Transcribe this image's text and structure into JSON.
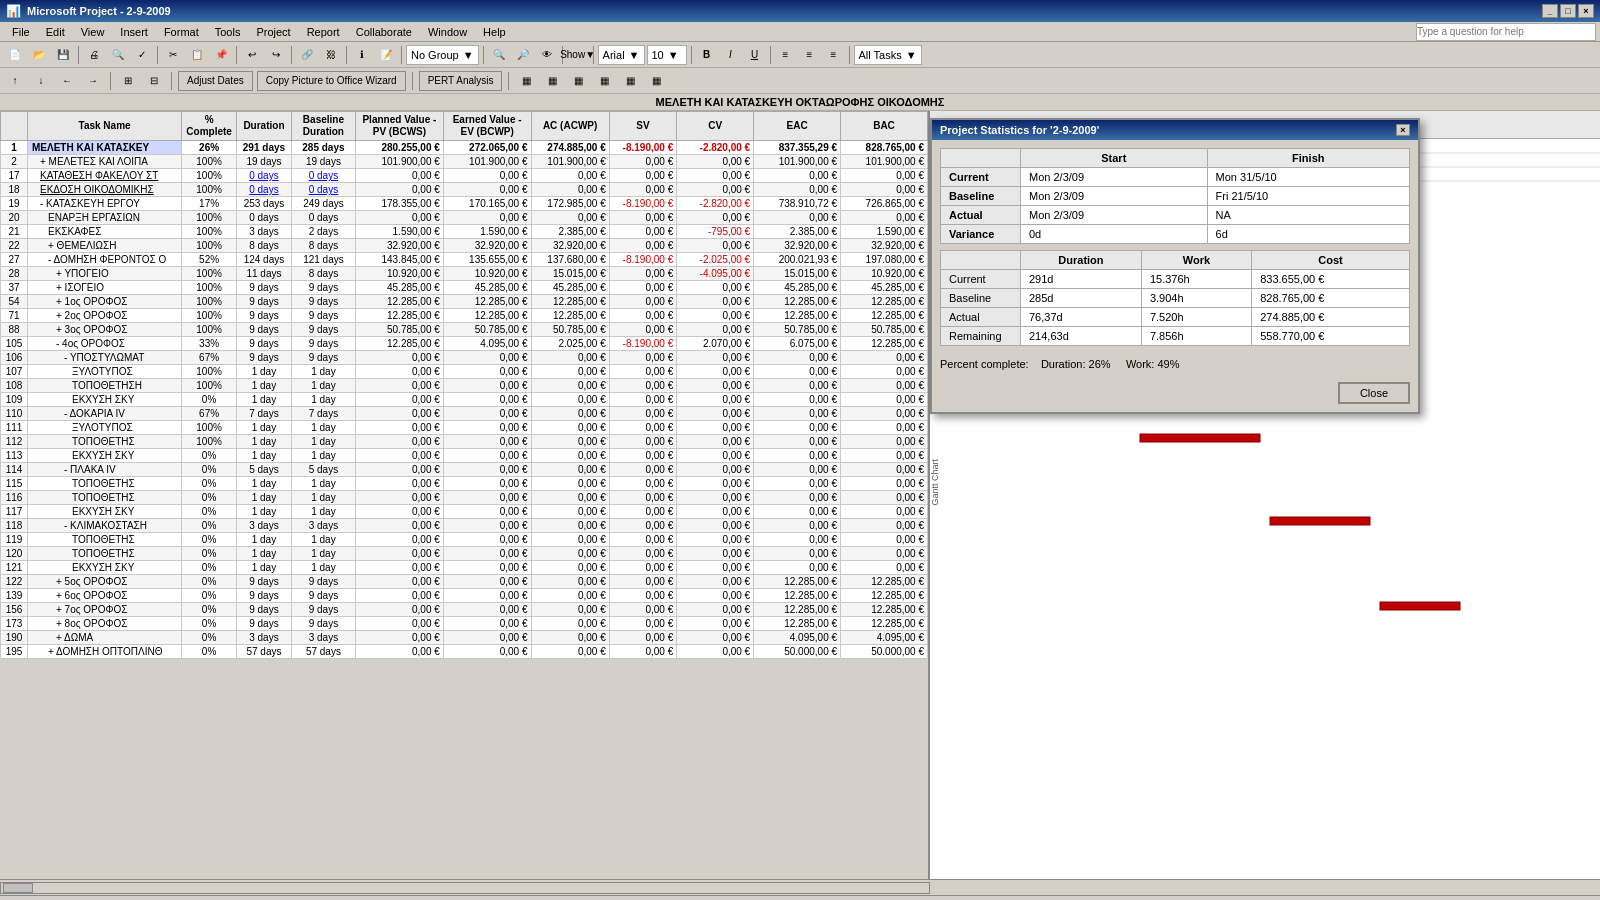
{
  "titleBar": {
    "title": "Microsoft Project - 2-9-2009",
    "buttons": [
      "_",
      "□",
      "×"
    ]
  },
  "menuBar": {
    "items": [
      "File",
      "Edit",
      "View",
      "Insert",
      "Format",
      "Tools",
      "Project",
      "Report",
      "Collaborate",
      "Window",
      "Help"
    ]
  },
  "toolbar": {
    "noGroup": "No Group",
    "fontSize": "10",
    "fontName": "Arial",
    "allTasks": "All Tasks",
    "show": "Show"
  },
  "toolbar2": {
    "adjustDates": "Adjust Dates",
    "copyPicture": "Copy Picture to Office Wizard",
    "pertAnalysis": "PERT Analysis"
  },
  "projectTitle": "ΜΕΛΕΤΗ ΚΑΙ ΚΑΤΑΣΚΕΥΗ ΟΚΤΑΩΡΟΦΗΣ ΟΙΚΟΔΟΜΗΣ",
  "tableHeaders": {
    "num": "#",
    "taskName": "Task Name",
    "pctComplete": "% Complete",
    "duration": "Duration",
    "baselineDuration": "Baseline Duration",
    "pv": "Planned Value - PV (BCWS)",
    "ev": "Earned Value - EV (BCWP)",
    "ac": "AC (ACWP)",
    "sv": "SV",
    "cv": "CV",
    "eac": "EAC",
    "bac": "BAC"
  },
  "rows": [
    {
      "num": "1",
      "name": "ΜΕΛΕΤΗ ΚΑΙ ΚΑΤΑΣΚΕΥ",
      "pct": "26%",
      "dur": "291 days",
      "base": "285 days",
      "pv": "280.255,00 €",
      "ev": "272.065,00 €",
      "ac": "274.885,00 €",
      "sv": "-8.190,00 €",
      "cv": "-2.820,00 €",
      "eac": "837.355,29 €",
      "bac": "828.765,00 €",
      "bold": true,
      "indent": 0
    },
    {
      "num": "2",
      "name": "+ ΜΕΛΕΤΕΣ ΚΑΙ ΛΟΙΠΑ",
      "pct": "100%",
      "dur": "19 days",
      "base": "19 days",
      "pv": "101.900,00 €",
      "ev": "101.900,00 €",
      "ac": "101.900,00 €",
      "sv": "0,00 €",
      "cv": "0,00 €",
      "eac": "101.900,00 €",
      "bac": "101.900,00 €",
      "bold": false,
      "indent": 1
    },
    {
      "num": "17",
      "name": "ΚΑΤΑΘΕΣΗ ΦΑΚΕΛΟΥ ΣΤ",
      "pct": "100%",
      "dur": "0 days",
      "base": "0 days",
      "pv": "0,00 €",
      "ev": "0,00 €",
      "ac": "0,00 €",
      "sv": "0,00 €",
      "cv": "0,00 €",
      "eac": "0,00 €",
      "bac": "0,00 €",
      "bold": false,
      "indent": 1,
      "underline": true
    },
    {
      "num": "18",
      "name": "ΕΚΔΟΣΗ ΟΙΚΟΔΟΜΙΚΗΣ",
      "pct": "100%",
      "dur": "0 days",
      "base": "0 days",
      "pv": "0,00 €",
      "ev": "0,00 €",
      "ac": "0,00 €",
      "sv": "0,00 €",
      "cv": "0,00 €",
      "eac": "0,00 €",
      "bac": "0,00 €",
      "bold": false,
      "indent": 1,
      "underline": true
    },
    {
      "num": "19",
      "name": "- ΚΑΤΑΣΚΕΥΗ ΕΡΓΟΥ",
      "pct": "17%",
      "dur": "253 days",
      "base": "249 days",
      "pv": "178.355,00 €",
      "ev": "170.165,00 €",
      "ac": "172.985,00 €",
      "sv": "-8.190,00 €",
      "cv": "-2.820,00 €",
      "eac": "738.910,72 €",
      "bac": "726.865,00 €",
      "bold": false,
      "indent": 1
    },
    {
      "num": "20",
      "name": "ΕΝΑΡΞΗ ΕΡΓΑΣΙΩΝ",
      "pct": "100%",
      "dur": "0 days",
      "base": "0 days",
      "pv": "0,00 €",
      "ev": "0,00 €",
      "ac": "0,00 €",
      "sv": "0,00 €",
      "cv": "0,00 €",
      "eac": "0,00 €",
      "bac": "0,00 €",
      "bold": false,
      "indent": 2
    },
    {
      "num": "21",
      "name": "ΕΚΣΚΑΦΕΣ",
      "pct": "100%",
      "dur": "3 days",
      "base": "2 days",
      "pv": "1.590,00 €",
      "ev": "1.590,00 €",
      "ac": "2.385,00 €",
      "sv": "0,00 €",
      "cv": "-795,00 €",
      "eac": "2.385,00 €",
      "bac": "1.590,00 €",
      "bold": false,
      "indent": 2
    },
    {
      "num": "22",
      "name": "+ ΘΕΜΕΛΙΩΣΗ",
      "pct": "100%",
      "dur": "8 days",
      "base": "8 days",
      "pv": "32.920,00 €",
      "ev": "32.920,00 €",
      "ac": "32.920,00 €",
      "sv": "0,00 €",
      "cv": "0,00 €",
      "eac": "32.920,00 €",
      "bac": "32.920,00 €",
      "bold": false,
      "indent": 2
    },
    {
      "num": "27",
      "name": "- ΔΟΜΗΣΗ ΦΕΡΟΝΤΟΣ Ο",
      "pct": "52%",
      "dur": "124 days",
      "base": "121 days",
      "pv": "143.845,00 €",
      "ev": "135.655,00 €",
      "ac": "137.680,00 €",
      "sv": "-8.190,00 €",
      "cv": "-2.025,00 €",
      "eac": "200.021,93 €",
      "bac": "197.080,00 €",
      "bold": false,
      "indent": 2
    },
    {
      "num": "28",
      "name": "+ ΥΠΟΓΕΙΟ",
      "pct": "100%",
      "dur": "11 days",
      "base": "8 days",
      "pv": "10.920,00 €",
      "ev": "10.920,00 €",
      "ac": "15.015,00 €",
      "sv": "0,00 €",
      "cv": "-4.095,00 €",
      "eac": "15.015,00 €",
      "bac": "10.920,00 €",
      "bold": false,
      "indent": 3
    },
    {
      "num": "37",
      "name": "+ ΙΣΟΓΕΙΟ",
      "pct": "100%",
      "dur": "9 days",
      "base": "9 days",
      "pv": "45.285,00 €",
      "ev": "45.285,00 €",
      "ac": "45.285,00 €",
      "sv": "0,00 €",
      "cv": "0,00 €",
      "eac": "45.285,00 €",
      "bac": "45.285,00 €",
      "bold": false,
      "indent": 3
    },
    {
      "num": "54",
      "name": "+ 1ος ΟΡΟΦΟΣ",
      "pct": "100%",
      "dur": "9 days",
      "base": "9 days",
      "pv": "12.285,00 €",
      "ev": "12.285,00 €",
      "ac": "12.285,00 €",
      "sv": "0,00 €",
      "cv": "0,00 €",
      "eac": "12.285,00 €",
      "bac": "12.285,00 €",
      "bold": false,
      "indent": 3
    },
    {
      "num": "71",
      "name": "+ 2ος ΟΡΟΦΟΣ",
      "pct": "100%",
      "dur": "9 days",
      "base": "9 days",
      "pv": "12.285,00 €",
      "ev": "12.285,00 €",
      "ac": "12.285,00 €",
      "sv": "0,00 €",
      "cv": "0,00 €",
      "eac": "12.285,00 €",
      "bac": "12.285,00 €",
      "bold": false,
      "indent": 3
    },
    {
      "num": "88",
      "name": "+ 3ος ΟΡΟΦΟΣ",
      "pct": "100%",
      "dur": "9 days",
      "base": "9 days",
      "pv": "50.785,00 €",
      "ev": "50.785,00 €",
      "ac": "50.785,00 €",
      "sv": "0,00 €",
      "cv": "0,00 €",
      "eac": "50.785,00 €",
      "bac": "50.785,00 €",
      "bold": false,
      "indent": 3
    },
    {
      "num": "105",
      "name": "- 4ος ΟΡΟΦΟΣ",
      "pct": "33%",
      "dur": "9 days",
      "base": "9 days",
      "pv": "12.285,00 €",
      "ev": "4.095,00 €",
      "ac": "2.025,00 €",
      "sv": "-8.190,00 €",
      "cv": "2.070,00 €",
      "eac": "6.075,00 €",
      "bac": "12.285,00 €",
      "bold": false,
      "indent": 3
    },
    {
      "num": "106",
      "name": "- ΥΠΟΣΤΥΛΩΜΑΤ",
      "pct": "67%",
      "dur": "9 days",
      "base": "9 days",
      "pv": "0,00 €",
      "ev": "0,00 €",
      "ac": "0,00 €",
      "sv": "0,00 €",
      "cv": "0,00 €",
      "eac": "0,00 €",
      "bac": "0,00 €",
      "bold": false,
      "indent": 4
    },
    {
      "num": "107",
      "name": "ΞΥΛΟΤΥΠΟΣ",
      "pct": "100%",
      "dur": "1 day",
      "base": "1 day",
      "pv": "0,00 €",
      "ev": "0,00 €",
      "ac": "0,00 €",
      "sv": "0,00 €",
      "cv": "0,00 €",
      "eac": "0,00 €",
      "bac": "0,00 €",
      "bold": false,
      "indent": 5
    },
    {
      "num": "108",
      "name": "ΤΟΠΟΘΕΤΗΣΗ",
      "pct": "100%",
      "dur": "1 day",
      "base": "1 day",
      "pv": "0,00 €",
      "ev": "0,00 €",
      "ac": "0,00 €",
      "sv": "0,00 €",
      "cv": "0,00 €",
      "eac": "0,00 €",
      "bac": "0,00 €",
      "bold": false,
      "indent": 5
    },
    {
      "num": "109",
      "name": "ΕΚΧΥΣΗ ΣΚΥ",
      "pct": "0%",
      "dur": "1 day",
      "base": "1 day",
      "pv": "0,00 €",
      "ev": "0,00 €",
      "ac": "0,00 €",
      "sv": "0,00 €",
      "cv": "0,00 €",
      "eac": "0,00 €",
      "bac": "0,00 €",
      "bold": false,
      "indent": 5
    },
    {
      "num": "110",
      "name": "- ΔΟΚΑΡΙΑ IV",
      "pct": "67%",
      "dur": "7 days",
      "base": "7 days",
      "pv": "0,00 €",
      "ev": "0,00 €",
      "ac": "0,00 €",
      "sv": "0,00 €",
      "cv": "0,00 €",
      "eac": "0,00 €",
      "bac": "0,00 €",
      "bold": false,
      "indent": 4
    },
    {
      "num": "111",
      "name": "ΞΥΛΟΤΥΠΟΣ",
      "pct": "100%",
      "dur": "1 day",
      "base": "1 day",
      "pv": "0,00 €",
      "ev": "0,00 €",
      "ac": "0,00 €",
      "sv": "0,00 €",
      "cv": "0,00 €",
      "eac": "0,00 €",
      "bac": "0,00 €",
      "bold": false,
      "indent": 5
    },
    {
      "num": "112",
      "name": "ΤΟΠΟΘΕΤΗΣ",
      "pct": "100%",
      "dur": "1 day",
      "base": "1 day",
      "pv": "0,00 €",
      "ev": "0,00 €",
      "ac": "0,00 €",
      "sv": "0,00 €",
      "cv": "0,00 €",
      "eac": "0,00 €",
      "bac": "0,00 €",
      "bold": false,
      "indent": 5
    },
    {
      "num": "113",
      "name": "ΕΚΧΥΣΗ ΣΚΥ",
      "pct": "0%",
      "dur": "1 day",
      "base": "1 day",
      "pv": "0,00 €",
      "ev": "0,00 €",
      "ac": "0,00 €",
      "sv": "0,00 €",
      "cv": "0,00 €",
      "eac": "0,00 €",
      "bac": "0,00 €",
      "bold": false,
      "indent": 5
    },
    {
      "num": "114",
      "name": "- ΠΛΑΚΑ IV",
      "pct": "0%",
      "dur": "5 days",
      "base": "5 days",
      "pv": "0,00 €",
      "ev": "0,00 €",
      "ac": "0,00 €",
      "sv": "0,00 €",
      "cv": "0,00 €",
      "eac": "0,00 €",
      "bac": "0,00 €",
      "bold": false,
      "indent": 4
    },
    {
      "num": "115",
      "name": "ΤΟΠΟΘΕΤΗΣ",
      "pct": "0%",
      "dur": "1 day",
      "base": "1 day",
      "pv": "0,00 €",
      "ev": "0,00 €",
      "ac": "0,00 €",
      "sv": "0,00 €",
      "cv": "0,00 €",
      "eac": "0,00 €",
      "bac": "0,00 €",
      "bold": false,
      "indent": 5
    },
    {
      "num": "116",
      "name": "ΤΟΠΟΘΕΤΗΣ",
      "pct": "0%",
      "dur": "1 day",
      "base": "1 day",
      "pv": "0,00 €",
      "ev": "0,00 €",
      "ac": "0,00 €",
      "sv": "0,00 €",
      "cv": "0,00 €",
      "eac": "0,00 €",
      "bac": "0,00 €",
      "bold": false,
      "indent": 5
    },
    {
      "num": "117",
      "name": "ΕΚΧΥΣΗ ΣΚΥ",
      "pct": "0%",
      "dur": "1 day",
      "base": "1 day",
      "pv": "0,00 €",
      "ev": "0,00 €",
      "ac": "0,00 €",
      "sv": "0,00 €",
      "cv": "0,00 €",
      "eac": "0,00 €",
      "bac": "0,00 €",
      "bold": false,
      "indent": 5
    },
    {
      "num": "118",
      "name": "- ΚΛΙΜΑΚΟΣΤΑΣΗ",
      "pct": "0%",
      "dur": "3 days",
      "base": "3 days",
      "pv": "0,00 €",
      "ev": "0,00 €",
      "ac": "0,00 €",
      "sv": "0,00 €",
      "cv": "0,00 €",
      "eac": "0,00 €",
      "bac": "0,00 €",
      "bold": false,
      "indent": 4
    },
    {
      "num": "119",
      "name": "ΤΟΠΟΘΕΤΗΣ",
      "pct": "0%",
      "dur": "1 day",
      "base": "1 day",
      "pv": "0,00 €",
      "ev": "0,00 €",
      "ac": "0,00 €",
      "sv": "0,00 €",
      "cv": "0,00 €",
      "eac": "0,00 €",
      "bac": "0,00 €",
      "bold": false,
      "indent": 5
    },
    {
      "num": "120",
      "name": "ΤΟΠΟΘΕΤΗΣ",
      "pct": "0%",
      "dur": "1 day",
      "base": "1 day",
      "pv": "0,00 €",
      "ev": "0,00 €",
      "ac": "0,00 €",
      "sv": "0,00 €",
      "cv": "0,00 €",
      "eac": "0,00 €",
      "bac": "0,00 €",
      "bold": false,
      "indent": 5
    },
    {
      "num": "121",
      "name": "ΕΚΧΥΣΗ ΣΚΥ",
      "pct": "0%",
      "dur": "1 day",
      "base": "1 day",
      "pv": "0,00 €",
      "ev": "0,00 €",
      "ac": "0,00 €",
      "sv": "0,00 €",
      "cv": "0,00 €",
      "eac": "0,00 €",
      "bac": "0,00 €",
      "bold": false,
      "indent": 5
    },
    {
      "num": "122",
      "name": "+ 5ος ΟΡΟΦΟΣ",
      "pct": "0%",
      "dur": "9 days",
      "base": "9 days",
      "pv": "0,00 €",
      "ev": "0,00 €",
      "ac": "0,00 €",
      "sv": "0,00 €",
      "cv": "0,00 €",
      "eac": "12.285,00 €",
      "bac": "12.285,00 €",
      "bold": false,
      "indent": 3
    },
    {
      "num": "139",
      "name": "+ 6ος ΟΡΟΦΟΣ",
      "pct": "0%",
      "dur": "9 days",
      "base": "9 days",
      "pv": "0,00 €",
      "ev": "0,00 €",
      "ac": "0,00 €",
      "sv": "0,00 €",
      "cv": "0,00 €",
      "eac": "12.285,00 €",
      "bac": "12.285,00 €",
      "bold": false,
      "indent": 3
    },
    {
      "num": "156",
      "name": "+ 7ος ΟΡΟΦΟΣ",
      "pct": "0%",
      "dur": "9 days",
      "base": "9 days",
      "pv": "0,00 €",
      "ev": "0,00 €",
      "ac": "0,00 €",
      "sv": "0,00 €",
      "cv": "0,00 €",
      "eac": "12.285,00 €",
      "bac": "12.285,00 €",
      "bold": false,
      "indent": 3
    },
    {
      "num": "173",
      "name": "+ 8ος ΟΡΟΦΟΣ",
      "pct": "0%",
      "dur": "9 days",
      "base": "9 days",
      "pv": "0,00 €",
      "ev": "0,00 €",
      "ac": "0,00 €",
      "sv": "0,00 €",
      "cv": "0,00 €",
      "eac": "12.285,00 €",
      "bac": "12.285,00 €",
      "bold": false,
      "indent": 3
    },
    {
      "num": "190",
      "name": "+ ΔΩΜΑ",
      "pct": "0%",
      "dur": "3 days",
      "base": "3 days",
      "pv": "0,00 €",
      "ev": "0,00 €",
      "ac": "0,00 €",
      "sv": "0,00 €",
      "cv": "0,00 €",
      "eac": "4.095,00 €",
      "bac": "4.095,00 €",
      "bold": false,
      "indent": 3
    },
    {
      "num": "195",
      "name": "+ ΔΟΜΗΣΗ ΟΠΤΟΠΛΙΝΘ",
      "pct": "0%",
      "dur": "57 days",
      "base": "57 days",
      "pv": "0,00 €",
      "ev": "0,00 €",
      "ac": "0,00 €",
      "sv": "0,00 €",
      "cv": "0,00 €",
      "eac": "50.000,00 €",
      "bac": "50.000,00 €",
      "bold": false,
      "indent": 2
    }
  ],
  "dialog": {
    "title": "Project Statistics for '2-9-2009'",
    "headers": {
      "startLabel": "Start",
      "finishLabel": "Finish"
    },
    "dates": {
      "currentStart": "Mon 2/3/09",
      "currentFinish": "Mon 31/5/10",
      "baselineStart": "Mon 2/3/09",
      "baselineFinish": "Fri 21/5/10",
      "actualStart": "Mon 2/3/09",
      "actualFinish": "NA",
      "varianceStart": "0d",
      "varianceFinish": "6d"
    },
    "stats": {
      "headers": [
        "",
        "Duration",
        "Work",
        "Cost"
      ],
      "current": [
        "Current",
        "291d",
        "15.376h",
        "833.655,00 €"
      ],
      "baseline": [
        "Baseline",
        "285d",
        "3.904h",
        "828.765,00 €"
      ],
      "actual": [
        "Actual",
        "76,37d",
        "7.520h",
        "274.885,00 €"
      ],
      "remaining": [
        "Remaining",
        "214,63d",
        "7.856h",
        "558.770,00 €"
      ]
    },
    "percentComplete": {
      "label": "Percent complete:",
      "duration": "Duration:  26%",
      "work": "Work:  49%"
    },
    "closeButton": "Close"
  }
}
